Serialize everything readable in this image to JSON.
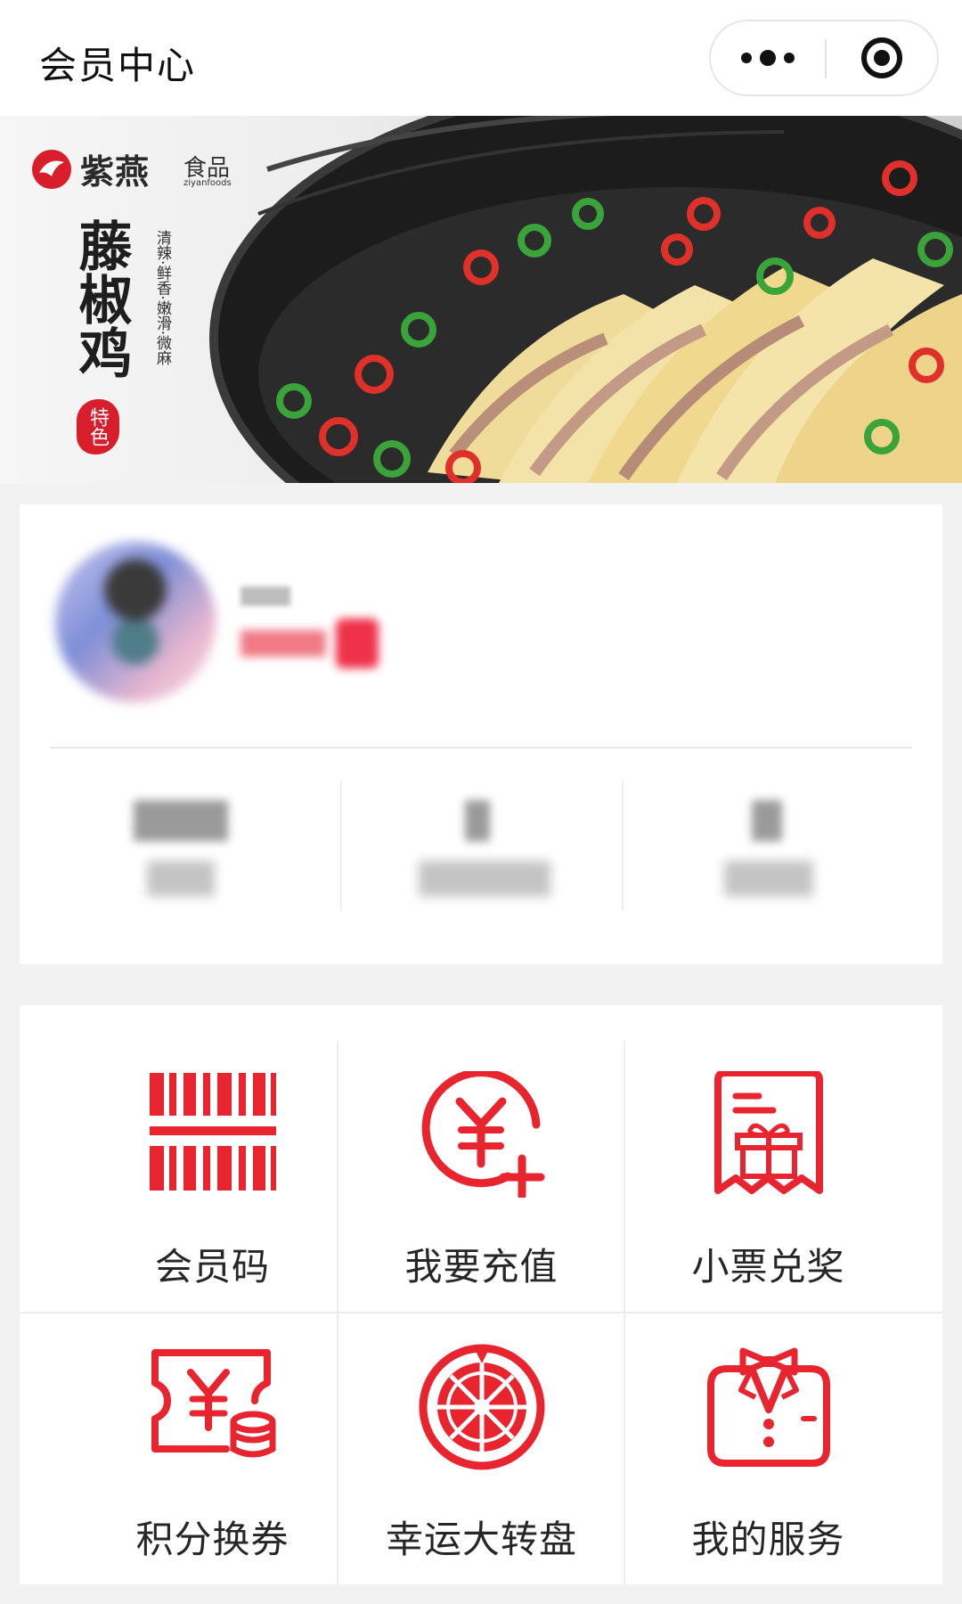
{
  "header": {
    "title": "会员中心",
    "more_icon": "more-dots-icon",
    "close_icon": "target-close-icon"
  },
  "banner": {
    "brand_name": "紫燕",
    "brand_suffix": "食品",
    "brand_en": "ziyanfoods",
    "dish_name": "藤椒鸡",
    "tagline": "清辣·鲜香·嫩滑·微麻",
    "seal_text": "特色"
  },
  "profile": {
    "nickname": "",
    "level_label": "",
    "level_badge": "",
    "stats": [
      {
        "value": "",
        "label": ""
      },
      {
        "value": "",
        "label": ""
      },
      {
        "value": "",
        "label": ""
      }
    ]
  },
  "menu": {
    "items": [
      {
        "label": "会员码",
        "icon": "barcode-icon"
      },
      {
        "label": "我要充值",
        "icon": "recharge-yen-icon"
      },
      {
        "label": "小票兑奖",
        "icon": "receipt-gift-icon"
      },
      {
        "label": "积分换券",
        "icon": "coupon-coins-icon"
      },
      {
        "label": "幸运大转盘",
        "icon": "lucky-wheel-icon"
      },
      {
        "label": "我的服务",
        "icon": "service-bowtie-icon"
      }
    ]
  },
  "colors": {
    "accent": "#e8242e",
    "background": "#f2f2f2"
  }
}
